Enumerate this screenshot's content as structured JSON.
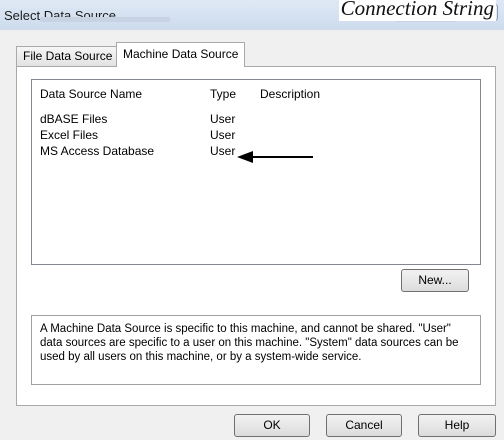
{
  "window": {
    "title": "Select Data Source",
    "caption": "Connection String"
  },
  "tabs": [
    {
      "label": "File Data Source",
      "active": false
    },
    {
      "label": "Machine Data Source",
      "active": true
    }
  ],
  "list": {
    "columns": [
      "Data Source Name",
      "Type",
      "Description"
    ],
    "rows": [
      {
        "name": "dBASE Files",
        "type": "User",
        "description": ""
      },
      {
        "name": "Excel Files",
        "type": "User",
        "description": ""
      },
      {
        "name": "MS Access Database",
        "type": "User",
        "description": ""
      }
    ]
  },
  "new_button": "New...",
  "description": "A Machine Data Source is specific to this machine, and cannot be shared. \"User\" data sources are specific to a user on this machine.  \"System\" data sources can be used by all users on this machine, or by a system-wide service.",
  "footer": {
    "ok": "OK",
    "cancel": "Cancel",
    "help": "Help"
  }
}
